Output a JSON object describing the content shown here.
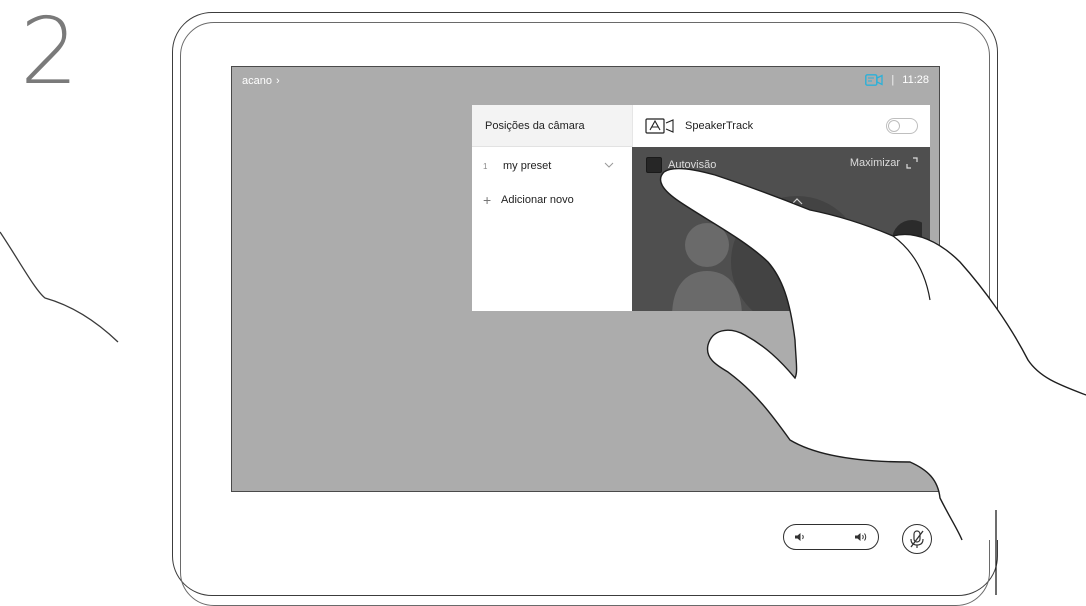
{
  "step_number": "2",
  "header": {
    "breadcrumb": "acano",
    "breadcrumb_chevron": "›",
    "separator": "|",
    "time": "11:28",
    "camera_status_icon": "camera-icon"
  },
  "camera_panel": {
    "presets_title": "Posições da câmara",
    "presets": [
      {
        "number": "1",
        "name": "my preset"
      }
    ],
    "add_new_label": "Adicionar novo",
    "speakertrack_label": "SpeakerTrack",
    "speakertrack_on": false,
    "autoview_label": "Autovisão",
    "maximize_label": "Maximizar"
  },
  "controls": {
    "volume_icons": [
      "speaker-low-icon",
      "speaker-high-icon"
    ],
    "mute_icon": "microphone-muted-icon"
  },
  "colors": {
    "screen_background": "#acacac",
    "preview_background": "#4f4f4f",
    "status_icon_color": "#2bb1d9"
  }
}
